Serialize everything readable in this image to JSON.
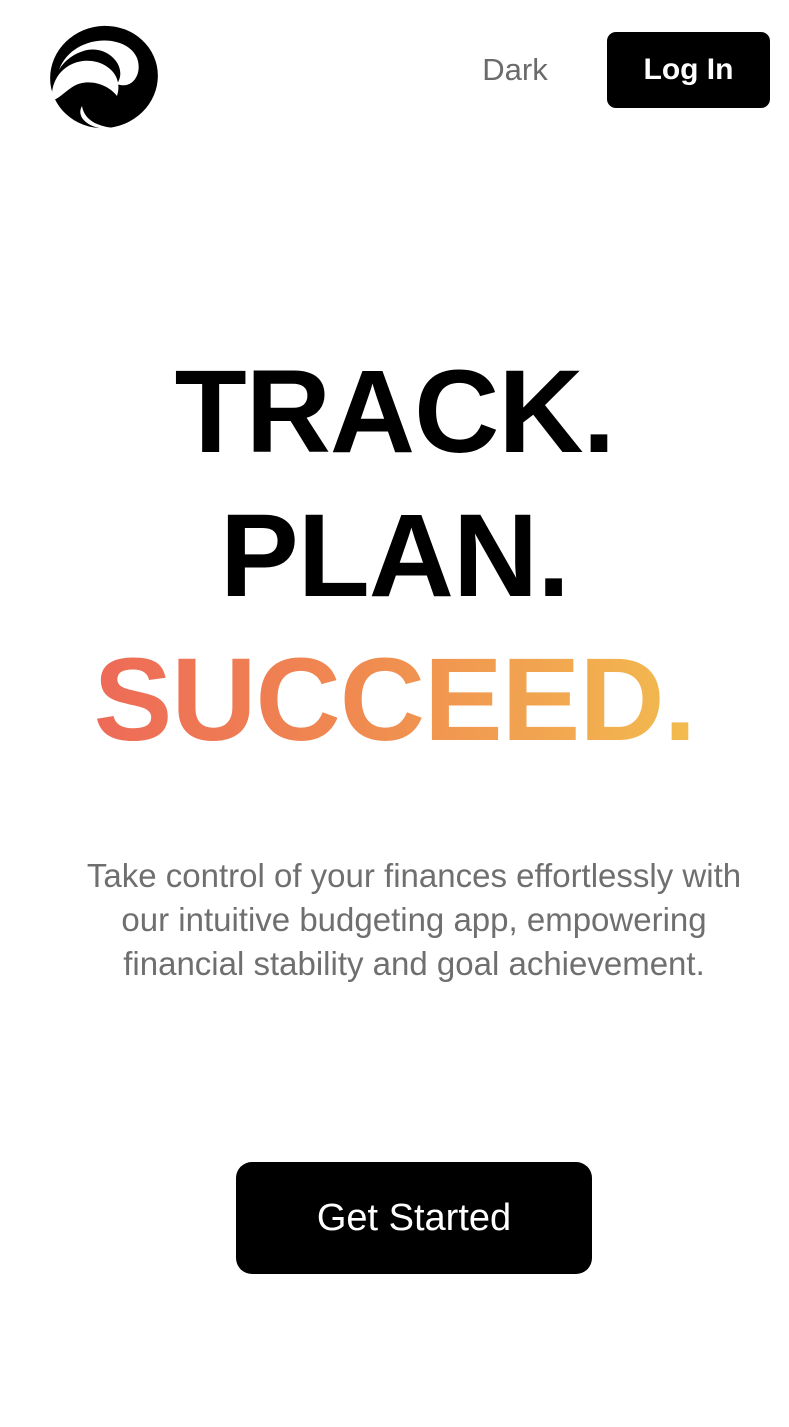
{
  "header": {
    "logo_icon": "swirl-logo-icon",
    "theme_toggle_label": "Dark",
    "login_label": "Log In"
  },
  "hero": {
    "line1": "TRACK.",
    "line2": "PLAN.",
    "line3": "SUCCEED.",
    "gradient_colors": [
      "#ec5e5a",
      "#f08a50",
      "#f3c94f"
    ]
  },
  "description": "Take control of your finances effortlessly with our intuitive budgeting app, empowering financial stability and goal achievement.",
  "cta": {
    "label": "Get Started"
  },
  "colors": {
    "primary": "#000000",
    "muted_text": "#6f6f6f",
    "background": "#ffffff"
  }
}
